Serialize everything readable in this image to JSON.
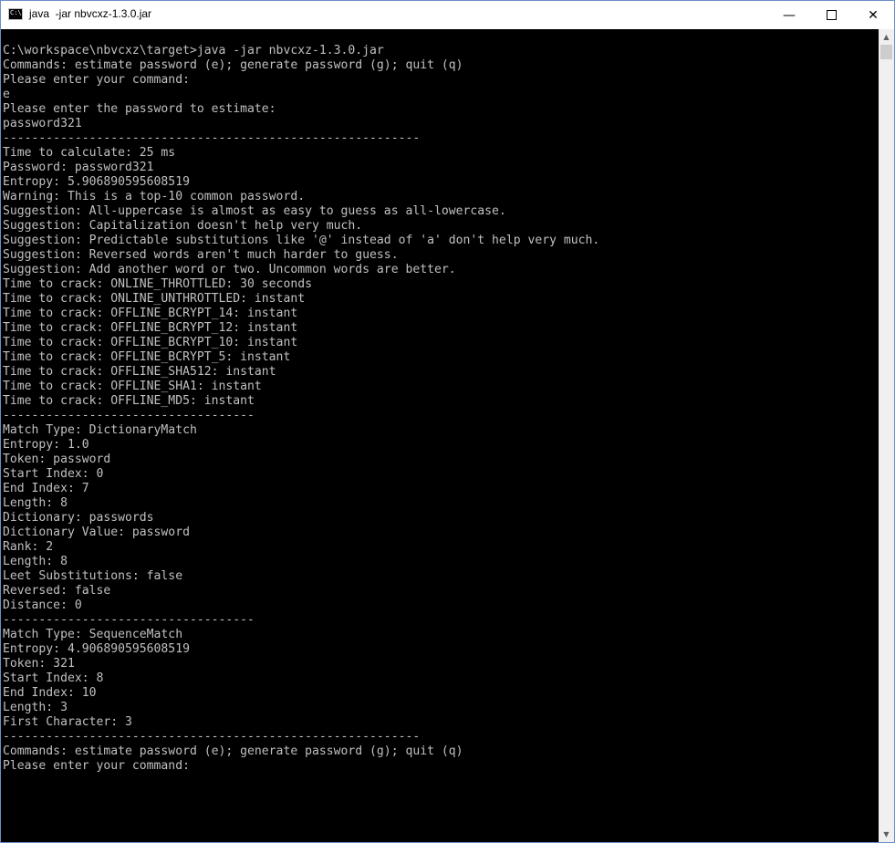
{
  "window": {
    "title": "java  -jar nbvcxz-1.3.0.jar",
    "icon": "console-icon",
    "icon_label": "C:\\",
    "controls": {
      "minimize": "—",
      "maximize": "",
      "close": "✕"
    }
  },
  "console": {
    "lines": [
      "C:\\workspace\\nbvcxz\\target>java -jar nbvcxz-1.3.0.jar",
      "Commands: estimate password (e); generate password (g); quit (q)",
      "Please enter your command:",
      "e",
      "Please enter the password to estimate:",
      "password321",
      "----------------------------------------------------------",
      "Time to calculate: 25 ms",
      "Password: password321",
      "Entropy: 5.906890595608519",
      "Warning: This is a top-10 common password.",
      "Suggestion: All-uppercase is almost as easy to guess as all-lowercase.",
      "Suggestion: Capitalization doesn't help very much.",
      "Suggestion: Predictable substitutions like '@' instead of 'a' don't help very much.",
      "Suggestion: Reversed words aren't much harder to guess.",
      "Suggestion: Add another word or two. Uncommon words are better.",
      "Time to crack: ONLINE_THROTTLED: 30 seconds",
      "Time to crack: ONLINE_UNTHROTTLED: instant",
      "Time to crack: OFFLINE_BCRYPT_14: instant",
      "Time to crack: OFFLINE_BCRYPT_12: instant",
      "Time to crack: OFFLINE_BCRYPT_10: instant",
      "Time to crack: OFFLINE_BCRYPT_5: instant",
      "Time to crack: OFFLINE_SHA512: instant",
      "Time to crack: OFFLINE_SHA1: instant",
      "Time to crack: OFFLINE_MD5: instant",
      "-----------------------------------",
      "Match Type: DictionaryMatch",
      "Entropy: 1.0",
      "Token: password",
      "Start Index: 0",
      "End Index: 7",
      "Length: 8",
      "Dictionary: passwords",
      "Dictionary Value: password",
      "Rank: 2",
      "Length: 8",
      "Leet Substitutions: false",
      "Reversed: false",
      "Distance: 0",
      "-----------------------------------",
      "Match Type: SequenceMatch",
      "Entropy: 4.906890595608519",
      "Token: 321",
      "Start Index: 8",
      "End Index: 10",
      "Length: 3",
      "First Character: 3",
      "----------------------------------------------------------",
      "Commands: estimate password (e); generate password (g); quit (q)",
      "Please enter your command:"
    ]
  },
  "scrollbar": {
    "up_arrow": "▲",
    "down_arrow": "▼"
  }
}
